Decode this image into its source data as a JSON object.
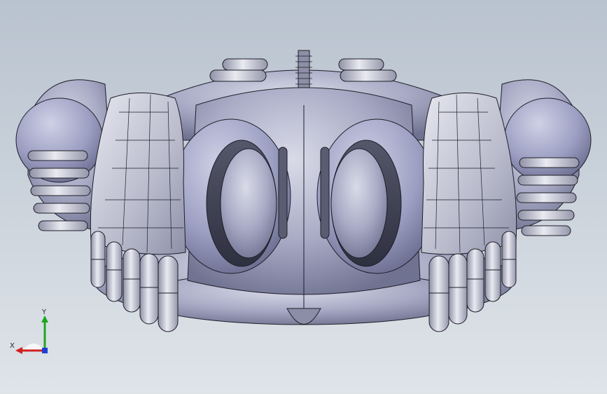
{
  "viewport": {
    "background_top": "#b9c3cf",
    "background_bottom": "#dfe4e9",
    "model_color": "#a7a9c4",
    "model_edge_color": "#1e1e28"
  },
  "triad": {
    "x_label": "X",
    "y_label": "Y",
    "x_color": "#d21f1f",
    "y_color": "#1fa51f",
    "z_color": "#1f3fd2"
  }
}
